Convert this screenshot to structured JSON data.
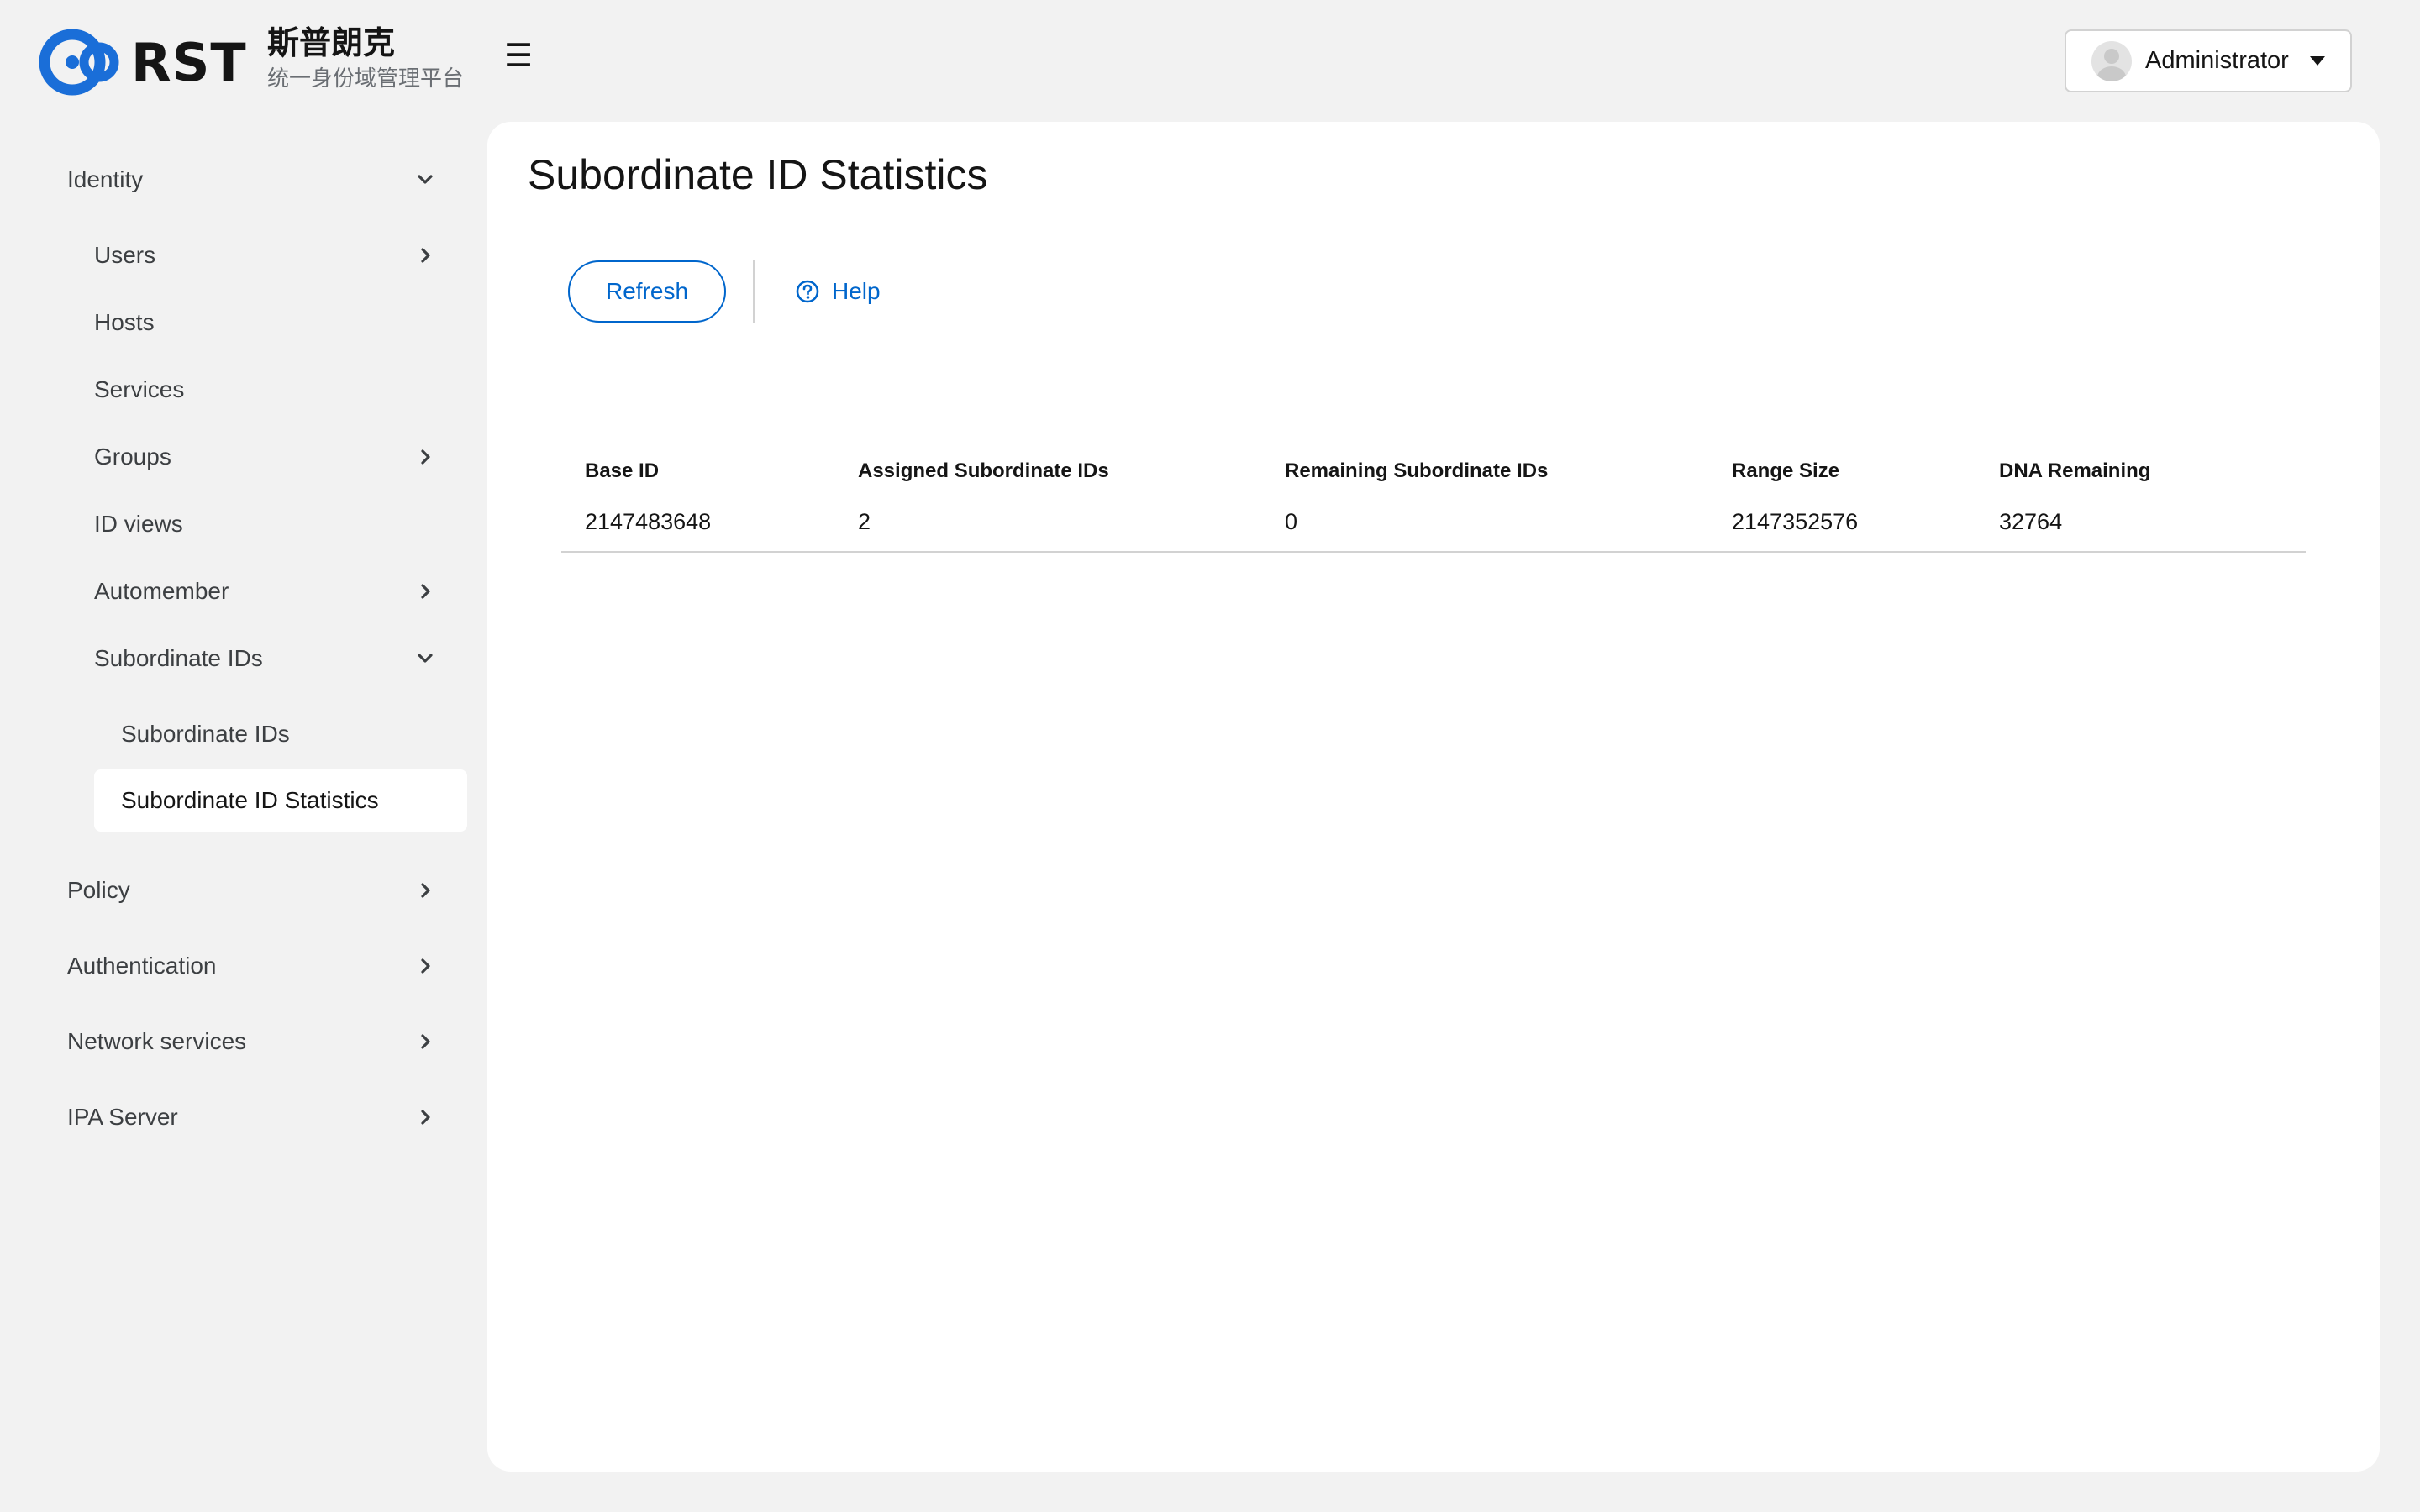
{
  "brand": {
    "name": "RST",
    "title_cn": "斯普朗克",
    "subtitle_cn": "统一身份域管理平台"
  },
  "header": {
    "nav_toggle_glyph": "☰",
    "user_name": "Administrator"
  },
  "sidebar": {
    "identity": "Identity",
    "users": "Users",
    "hosts": "Hosts",
    "services": "Services",
    "groups": "Groups",
    "id_views": "ID views",
    "automember": "Automember",
    "subordinate_ids": "Subordinate IDs",
    "subordinate_ids_child": "Subordinate IDs",
    "subordinate_id_statistics": "Subordinate ID Statistics",
    "policy": "Policy",
    "authentication": "Authentication",
    "network_services": "Network services",
    "ipa_server": "IPA Server"
  },
  "page": {
    "title": "Subordinate ID Statistics",
    "refresh_label": "Refresh",
    "help_label": "Help"
  },
  "table": {
    "headers": [
      "Base ID",
      "Assigned Subordinate IDs",
      "Remaining Subordinate IDs",
      "Range Size",
      "DNA Remaining"
    ],
    "rows": [
      [
        "2147483648",
        "2",
        "0",
        "2147352576",
        "32764"
      ]
    ]
  },
  "colors": {
    "accent": "#0066cc",
    "logo_blue": "#1a6ed8",
    "background": "#f2f2f2"
  }
}
